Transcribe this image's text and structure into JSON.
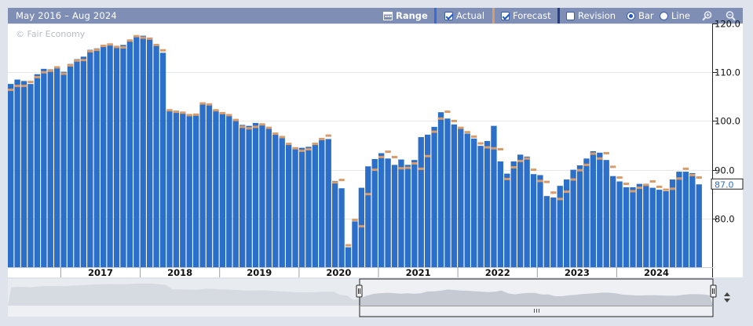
{
  "toolbar": {
    "range_text": "May 2016 – Aug 2024",
    "range_button": "Range",
    "actual_label": "Actual",
    "forecast_label": "Forecast",
    "revision_label": "Revision",
    "bar_label": "Bar",
    "line_label": "Line",
    "actual_checked": true,
    "forecast_checked": true,
    "revision_checked": false,
    "mode": "bar"
  },
  "watermark": "© Fair Economy",
  "colors": {
    "actual_bar": "#2c6fc9",
    "forecast_marker": "#d89c6a",
    "toolbar_bg": "#7f8eb5",
    "navigator_fill": "#c6cad3"
  },
  "last_value_label": "87.0",
  "icons": [
    "calendar-icon",
    "zoom-in-icon",
    "zoom-out-icon",
    "scroll-arrows-icon",
    "navigator-handle-icon"
  ],
  "chart_data": {
    "type": "bar",
    "x_start": "2016-05",
    "x_end": "2024-08",
    "frequency": "monthly",
    "ylim": [
      70,
      120
    ],
    "yticks": [
      80.0,
      90.0,
      100.0,
      110.0,
      120.0
    ],
    "ytick_labels": [
      "80.0",
      "90.0",
      "100.0",
      "110.0",
      "120.0"
    ],
    "xtick_labels": [
      "2017",
      "2018",
      "2019",
      "2020",
      "2021",
      "2022",
      "2023",
      "2024"
    ],
    "grid": true,
    "series": [
      {
        "name": "Actual",
        "values": [
          107.6,
          108.5,
          108.2,
          107.6,
          109.6,
          110.7,
          110.6,
          111.0,
          110.1,
          111.7,
          112.7,
          113.2,
          114.6,
          114.9,
          115.6,
          115.8,
          115.4,
          115.6,
          116.5,
          117.4,
          117.5,
          117.0,
          115.5,
          114.0,
          102.2,
          102.1,
          101.6,
          101.4,
          101.5,
          103.8,
          103.5,
          102.2,
          101.8,
          101.3,
          100.4,
          99.2,
          99.0,
          99.6,
          99.4,
          98.4,
          97.2,
          96.5,
          95.1,
          94.6,
          94.5,
          94.7,
          95.5,
          96.1,
          96.3,
          87.7,
          86.2,
          74.1,
          79.4,
          86.3,
          90.7,
          92.2,
          93.4,
          92.3,
          91.0,
          92.1,
          91.0,
          92.0,
          96.7,
          97.2,
          98.8,
          101.8,
          100.5,
          99.3,
          98.6,
          97.4,
          96.4,
          94.9,
          95.9,
          99.0,
          91.7,
          89.2,
          91.7,
          93.1,
          92.7,
          89.1,
          88.9,
          84.6,
          84.3,
          86.7,
          88.0,
          90.0,
          90.9,
          92.3,
          93.8,
          93.5,
          92.0,
          88.7,
          87.6,
          86.4,
          86.4,
          87.1,
          87.0,
          86.3,
          85.9,
          85.6,
          88.0,
          89.6,
          89.6,
          89.3,
          87.0
        ],
        "forecast": [
          106.4,
          107.2,
          107.2,
          108.0,
          109.0,
          110.0,
          110.3,
          111.0,
          109.7,
          111.4,
          112.4,
          112.5,
          114.3,
          114.6,
          115.4,
          115.7,
          115.2,
          115.1,
          116.5,
          117.4,
          117.1,
          116.9,
          115.6,
          114.5,
          102.2,
          101.9,
          101.7,
          101.2,
          101.3,
          103.6,
          103.4,
          102.2,
          101.6,
          101.2,
          100.2,
          98.8,
          98.5,
          98.8,
          99.3,
          98.6,
          97.4,
          96.7,
          95.3,
          94.4,
          93.9,
          94.2,
          95.3,
          96.3,
          97.0,
          87.4,
          87.9,
          74.5,
          79.7,
          78.4,
          85.0,
          90.0,
          92.6,
          93.7,
          92.6,
          90.3,
          90.4,
          91.3,
          90.2,
          92.8,
          97.8,
          100.5,
          101.9,
          100.0,
          98.6,
          97.7,
          96.8,
          95.4,
          94.6,
          94.4,
          94.2,
          88.1,
          90.5,
          91.8,
          92.3,
          90.0,
          87.7,
          87.5,
          85.3,
          84.0,
          85.5,
          88.0,
          89.9,
          91.0,
          93.3,
          92.3,
          93.4,
          90.6,
          88.4,
          87.1,
          85.6,
          86.3,
          86.9,
          87.6,
          86.5,
          85.9,
          86.1,
          88.2,
          90.2,
          88.9,
          88.4
        ]
      }
    ]
  }
}
